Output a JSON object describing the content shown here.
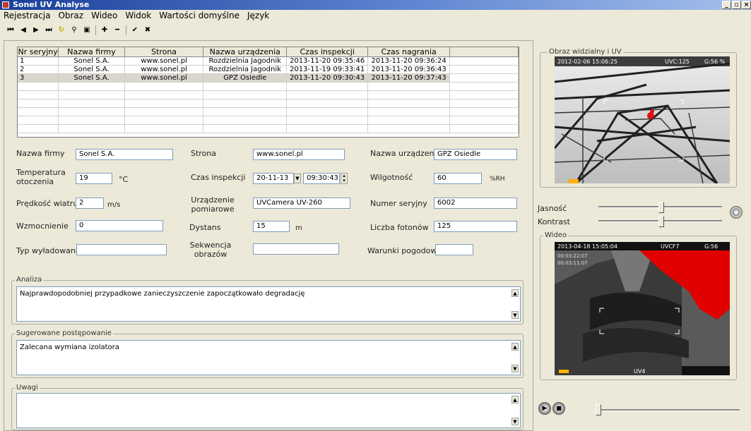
{
  "window": {
    "title": "Sonel UV Analyse"
  },
  "menu": [
    "Rejestracja",
    "Obraz",
    "Wideo",
    "Widok",
    "Wartości domyślne",
    "Język"
  ],
  "toolbar_icons": [
    "first-icon",
    "prev-icon",
    "next-icon",
    "last-icon",
    "refresh-icon",
    "binoculars-icon",
    "export-icon",
    "add-icon",
    "remove-icon",
    "confirm-icon",
    "cancel-icon"
  ],
  "toolbar_glyphs": [
    "⏮",
    "◀",
    "▶",
    "⏭",
    "↻",
    "⚲",
    "▣",
    "✚",
    "━",
    "✔",
    "✖"
  ],
  "table": {
    "columns": [
      "Nr seryjny",
      "Nazwa firmy",
      "Strona",
      "Nazwa urządzenia",
      "Czas inspekcji",
      "Czas nagrania"
    ],
    "rows": [
      [
        "1",
        "Sonel S.A.",
        "www.sonel.pl",
        "Rozdzielnia Jagodnik",
        "2013-11-20 09:35:46",
        "2013-11-20 09:36:24"
      ],
      [
        "2",
        "Sonel S.A.",
        "www.sonel.pl",
        "Rozdzielnia Jagodnik",
        "2013-11-19 09:33:41",
        "2013-11-20 09:36:43"
      ],
      [
        "3",
        "Sonel S.A.",
        "www.sonel.pl",
        "GPZ Osiedle",
        "2013-11-20 09:30:43",
        "2013-11-20 09:37:43"
      ]
    ]
  },
  "form": {
    "company_label": "Nazwa firmy",
    "company_value": "Sonel S.A.",
    "site_label": "Strona",
    "site_value": "www.sonel.pl",
    "device_label": "Nazwa urządzenia",
    "device_value": "GPZ Osiedle",
    "temp_label": "Temperatura otoczenia",
    "temp_value": "19",
    "temp_unit": "°C",
    "insp_label": "Czas inspekcji",
    "insp_date": "20-11-13",
    "insp_time": "09:30:43",
    "humidity_label": "Wilgotność",
    "humidity_value": "60",
    "humidity_unit": "%RH",
    "wind_label": "Prędkość wiatru",
    "wind_value": "2",
    "wind_unit": "m/s",
    "meas_label": "Urządzenie pomiarowe",
    "meas_value": "UVCamera UV-260",
    "serial_label": "Numer seryjny",
    "serial_value": "6002",
    "gain_label": "Wzmocnienie",
    "gain_value": "0",
    "distance_label": "Dystans",
    "distance_value": "15",
    "distance_unit": "m",
    "photons_label": "Liczba fotonów",
    "photons_value": "125",
    "discharge_label": "Typ wyładowania",
    "discharge_value": "",
    "sequence_label": "Sekwencja obrazów",
    "sequence_value": "",
    "weather_label": "Warunki pogodowe",
    "weather_value": ""
  },
  "analysis": {
    "title": "Analiza",
    "text": "Najprawdopodobniej przypadkowe zanieczyszczenie zapoczątkowało degradację"
  },
  "suggested": {
    "title": "Sugerowane postępowanie",
    "text": "Zalecana wymiana izolatora"
  },
  "notes": {
    "title": "Uwagi",
    "text": ""
  },
  "image_panel": {
    "title": "Obraz widzialny i UV",
    "overlay_left": "2012-02-06 15:06:25",
    "overlay_mid": "UVC:125",
    "overlay_right": "G:56 %"
  },
  "sliders": {
    "brightness_label": "Jasność",
    "contrast_label": "Kontrast"
  },
  "video_panel": {
    "title": "Wideo",
    "overlay_left": "2013-04-18 15:05:04",
    "overlay_mid": "UVCF7",
    "overlay_right": "G:56",
    "line2": "00:03:22:07",
    "line3": "00:03:11:07",
    "bottom_label": "UV4"
  }
}
